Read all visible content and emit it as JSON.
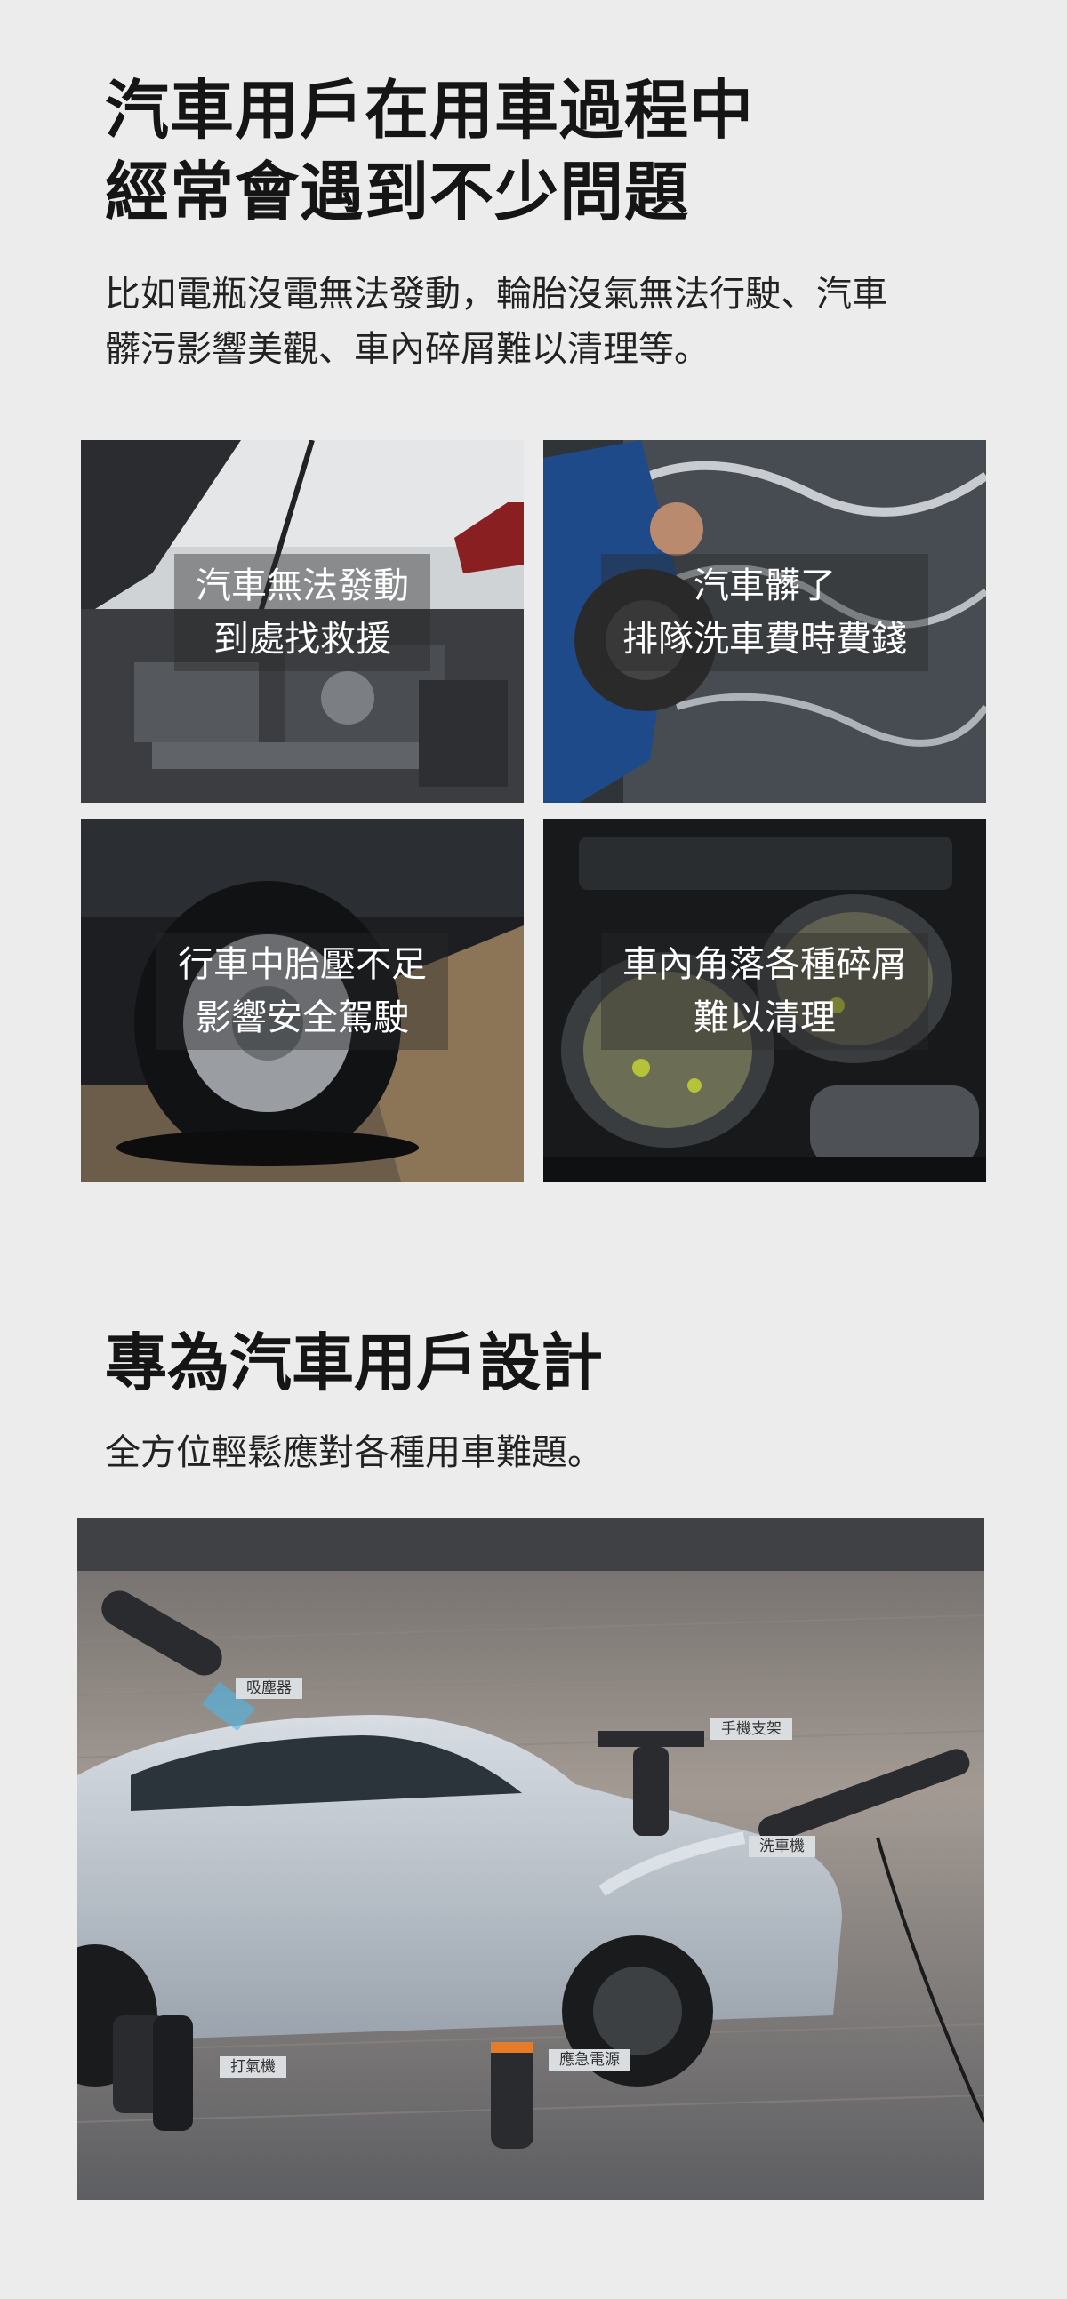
{
  "section1": {
    "title_lines": [
      "汽車用戶在用車過程中",
      "經常會遇到不少問題"
    ],
    "desc_lines": [
      "比如電瓶沒電無法發動，輪胎沒氣無法行駛、汽車",
      "髒污影響美觀、車內碎屑難以清理等。"
    ]
  },
  "tiles": [
    {
      "lines": [
        "汽車無法發動",
        "到處找救援"
      ]
    },
    {
      "lines": [
        "汽車髒了",
        "排隊洗車費時費錢"
      ]
    },
    {
      "lines": [
        "行車中胎壓不足",
        "影響安全駕駛"
      ]
    },
    {
      "lines": [
        "車內角落各種碎屑",
        "難以清理"
      ]
    }
  ],
  "section2": {
    "title": "專為汽車用戶設計",
    "desc": "全方位輕鬆應對各種用車難題。"
  },
  "hero_labels": {
    "vacuum": "吸塵器",
    "phone_holder": "手機支架",
    "washer": "洗車機",
    "inflator": "打氣機",
    "jump_starter": "應急電源"
  }
}
